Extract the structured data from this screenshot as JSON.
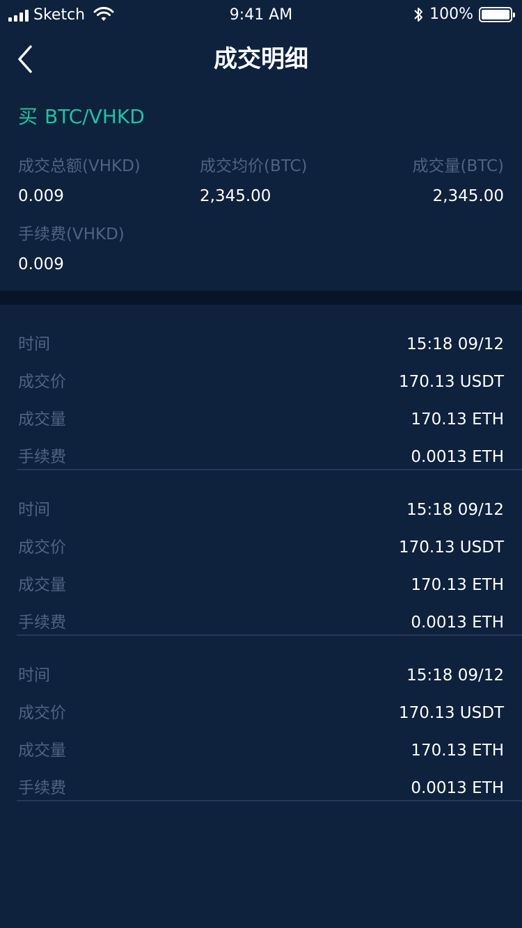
{
  "status_bar": {
    "carrier": "Sketch",
    "time": "9:41 AM",
    "battery": "100%"
  },
  "nav": {
    "back_icon": "chevron-left-icon",
    "title": "成交明细"
  },
  "summary": {
    "side": "买",
    "pair": "BTC/VHKD",
    "total_label": "成交总额(VHKD)",
    "total_value": "0.009",
    "avg_price_label": "成交均价(BTC)",
    "avg_price_value": "2,345.00",
    "volume_label": "成交量(BTC)",
    "volume_value": "2,345.00",
    "fee_label": "手续费(VHKD)",
    "fee_value": "0.009"
  },
  "colors": {
    "background": "#0e213d",
    "accent_green": "#1fc4a0",
    "label_gray": "#4f6482",
    "band": "#081528"
  },
  "records": [
    {
      "time_label": "时间",
      "time_value": "15:18 09/12",
      "price_label": "成交价",
      "price_value": "170.13 USDT",
      "volume_label": "成交量",
      "volume_value": "170.13 ETH",
      "fee_label": "手续费",
      "fee_value": "0.0013 ETH"
    },
    {
      "time_label": "时间",
      "time_value": "15:18 09/12",
      "price_label": "成交价",
      "price_value": "170.13 USDT",
      "volume_label": "成交量",
      "volume_value": "170.13 ETH",
      "fee_label": "手续费",
      "fee_value": "0.0013 ETH"
    },
    {
      "time_label": "时间",
      "time_value": "15:18 09/12",
      "price_label": "成交价",
      "price_value": "170.13 USDT",
      "volume_label": "成交量",
      "volume_value": "170.13 ETH",
      "fee_label": "手续费",
      "fee_value": "0.0013 ETH"
    }
  ]
}
